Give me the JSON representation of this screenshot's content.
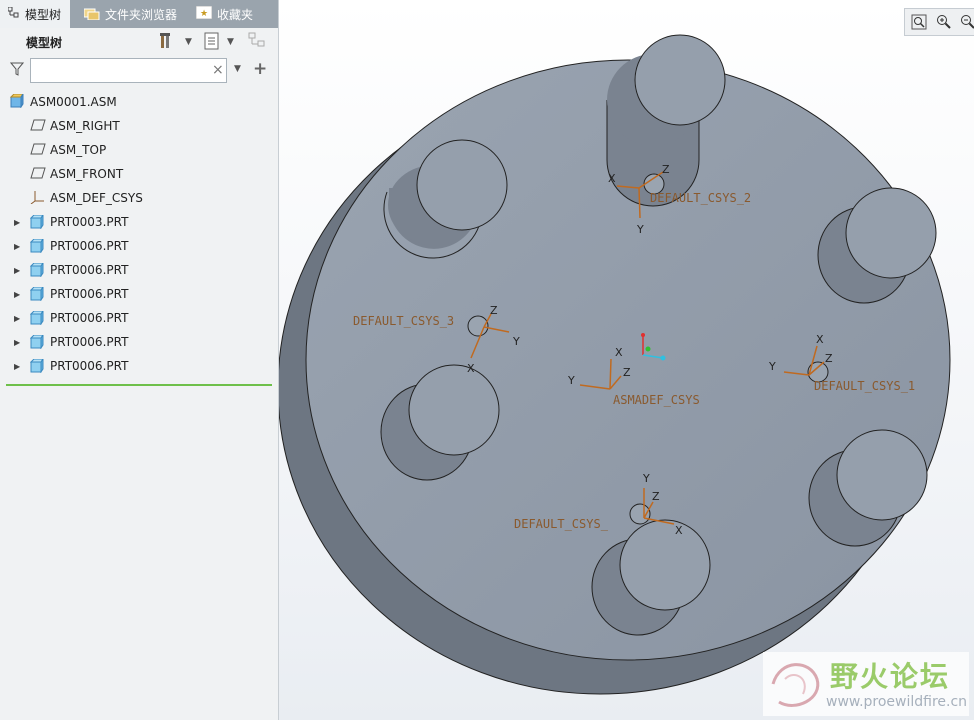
{
  "left_panel": {
    "tabs": [
      {
        "label": "模型树",
        "icon": "model-tree-icon",
        "active": true
      },
      {
        "label": "文件夹浏览器",
        "icon": "folder-browser-icon",
        "active": false
      },
      {
        "label": "收藏夹",
        "icon": "favorites-icon",
        "active": false
      }
    ],
    "tree_title": "模型树",
    "search": {
      "value": "",
      "placeholder": ""
    },
    "tree_items": [
      {
        "label": "ASM0001.ASM",
        "icon": "assembly-icon",
        "expandable": false
      },
      {
        "label": "ASM_RIGHT",
        "icon": "datum-plane-icon",
        "expandable": false
      },
      {
        "label": "ASM_TOP",
        "icon": "datum-plane-icon",
        "expandable": false
      },
      {
        "label": "ASM_FRONT",
        "icon": "datum-plane-icon",
        "expandable": false
      },
      {
        "label": "ASM_DEF_CSYS",
        "icon": "csys-icon",
        "expandable": false
      },
      {
        "label": "PRT0003.PRT",
        "icon": "part-icon",
        "expandable": true
      },
      {
        "label": "PRT0006.PRT",
        "icon": "part-icon",
        "expandable": true
      },
      {
        "label": "PRT0006.PRT",
        "icon": "part-icon",
        "expandable": true
      },
      {
        "label": "PRT0006.PRT",
        "icon": "part-icon",
        "expandable": true
      },
      {
        "label": "PRT0006.PRT",
        "icon": "part-icon",
        "expandable": true
      },
      {
        "label": "PRT0006.PRT",
        "icon": "part-icon",
        "expandable": true
      },
      {
        "label": "PRT0006.PRT",
        "icon": "part-icon",
        "expandable": true
      }
    ]
  },
  "viewport": {
    "toolbar_icons": [
      "refit-icon",
      "zoom-in-icon",
      "zoom-out-icon"
    ],
    "csys_labels": {
      "csys2": "DEFAULT_CSYS_2",
      "csys3": "DEFAULT_CSYS_3",
      "csys1": "DEFAULT_CSYS_1",
      "csys4": "DEFAULT_CSYS_",
      "center": "ASMADEF_CSYS"
    },
    "axis_labels": {
      "x": "X",
      "y": "Y",
      "z": "Z"
    },
    "colors": {
      "body": "#8e98a6",
      "body_side": "#6f7883",
      "csys_text": "#8a5a2e",
      "axis_arrow": "#c06a20"
    }
  },
  "watermark": {
    "name": "野火论坛",
    "url": "www.proewildfire.cn"
  }
}
